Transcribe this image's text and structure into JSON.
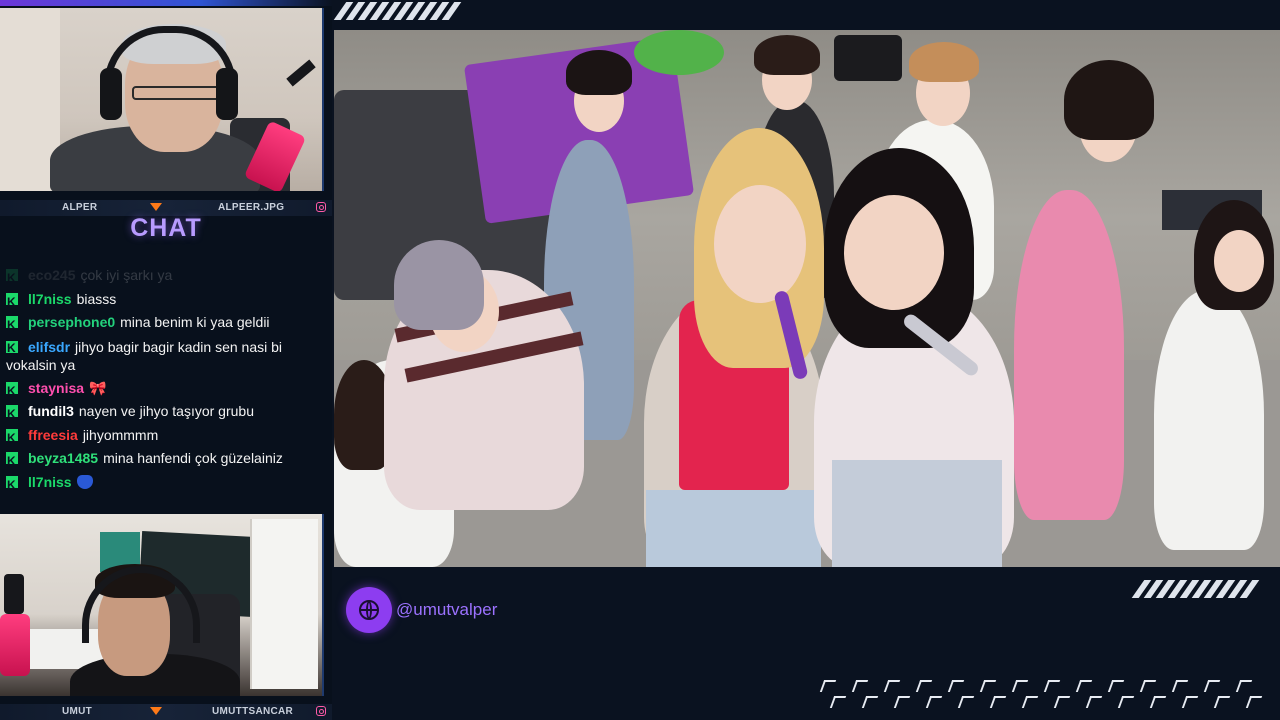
{
  "overlay": {
    "chat_title": "CHAT",
    "social_handle": "@umutvalper",
    "social_icon": "globe-icon",
    "accent_color": "#8d3df0",
    "badge_color": "#1bd96a"
  },
  "webcam_top": {
    "left_name": "ALPER",
    "right_name": "ALPEER.JPG"
  },
  "webcam_bottom": {
    "left_name": "UMUT",
    "right_name": "UMUTTSANCAR"
  },
  "chat": {
    "messages": [
      {
        "user": "eco245",
        "text": "çok iyi şarkı ya",
        "color": "#8a8a8a",
        "faded": true
      },
      {
        "user": "ll7niss",
        "text": "biasss",
        "color": "#1bd96a"
      },
      {
        "user": "persephone0",
        "text": "mina benim ki yaa geldii",
        "color": "#23d27c"
      },
      {
        "user": "elifsdr",
        "text": "jihyo bagir bagir kadin sen nasi bi vokalsin ya",
        "color": "#3aa8ff"
      },
      {
        "user": "staynisa",
        "text": "🎀",
        "color": "#ff4fae"
      },
      {
        "user": "fundil3",
        "text": "nayen ve jihyo taşıyor grubu",
        "color": "#ffffff"
      },
      {
        "user": "ffreesia",
        "text": "jihyommmm",
        "color": "#ff3b3b"
      },
      {
        "user": "beyza1485",
        "text": "mina hanfendi çok güzelainiz",
        "color": "#2fe07a"
      },
      {
        "user": "ll7niss",
        "text": "",
        "color": "#1bd96a"
      }
    ]
  }
}
